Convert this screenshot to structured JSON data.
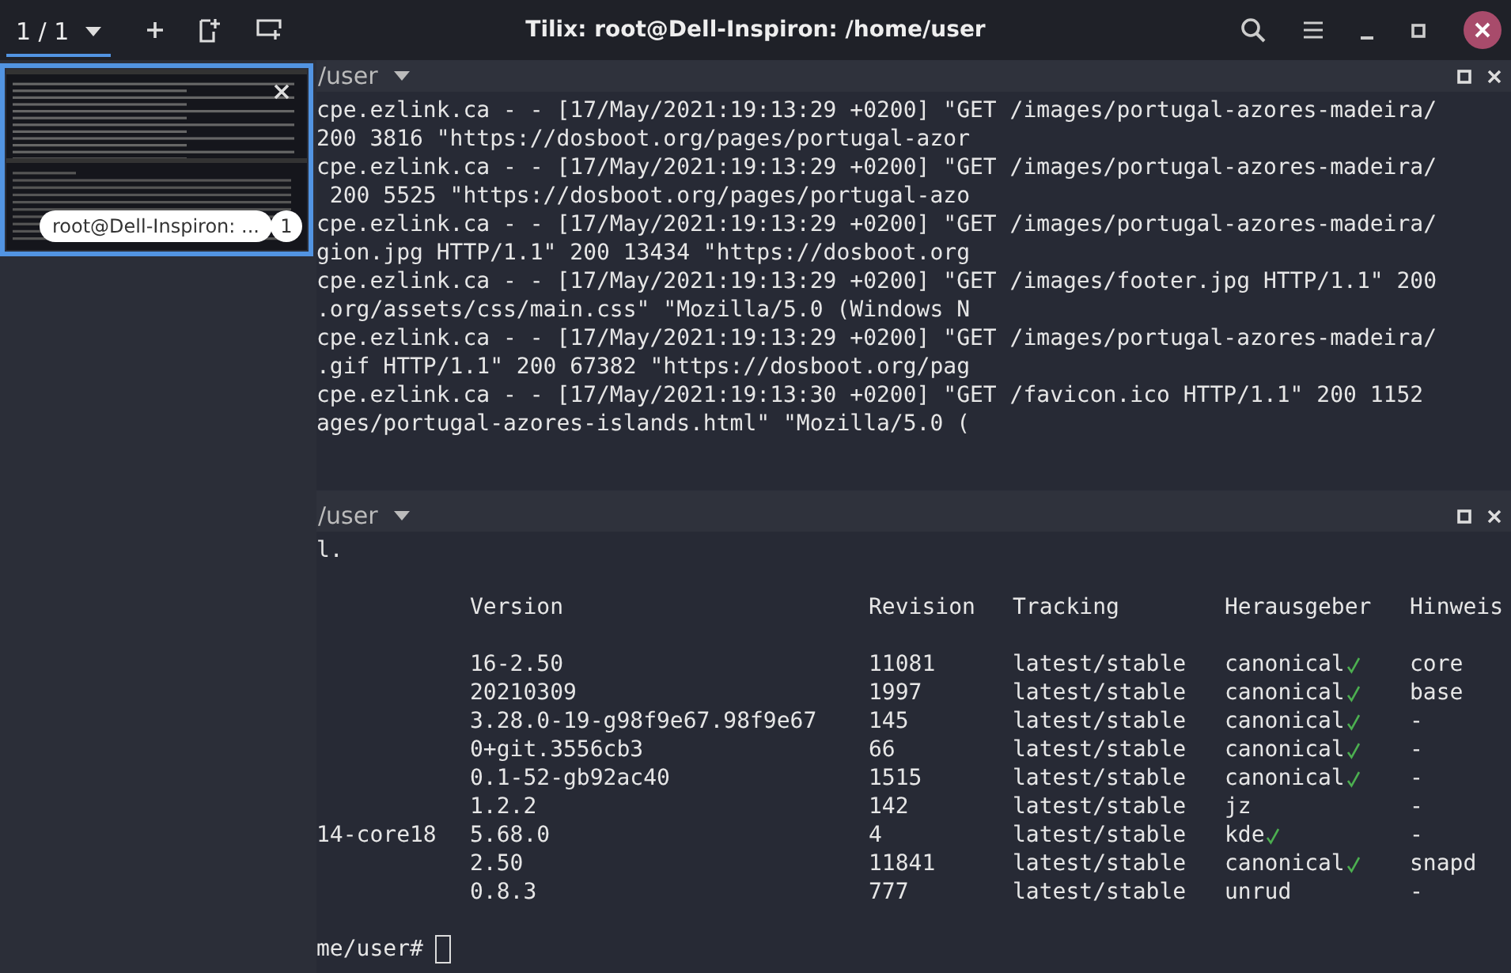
{
  "header": {
    "session_switcher": "1 / 1",
    "title": "Tilix: root@Dell-Inspiron: /home/user"
  },
  "sidebar": {
    "sessions": [
      {
        "label": "root@Dell-Inspiron: ...",
        "number": "1",
        "selected": true
      }
    ]
  },
  "panes": [
    {
      "title": "/user",
      "lines": [
        "cpe.ezlink.ca - - [17/May/2021:19:13:29 +0200] \"GET /images/portugal-azores-madeira/",
        "200 3816 \"https://dosboot.org/pages/portugal-azor",
        "cpe.ezlink.ca - - [17/May/2021:19:13:29 +0200] \"GET /images/portugal-azores-madeira/",
        " 200 5525 \"https://dosboot.org/pages/portugal-azo",
        "cpe.ezlink.ca - - [17/May/2021:19:13:29 +0200] \"GET /images/portugal-azores-madeira/",
        "gion.jpg HTTP/1.1\" 200 13434 \"https://dosboot.org",
        "cpe.ezlink.ca - - [17/May/2021:19:13:29 +0200] \"GET /images/footer.jpg HTTP/1.1\" 200",
        ".org/assets/css/main.css\" \"Mozilla/5.0 (Windows N",
        "cpe.ezlink.ca - - [17/May/2021:19:13:29 +0200] \"GET /images/portugal-azores-madeira/",
        ".gif HTTP/1.1\" 200 67382 \"https://dosboot.org/pag",
        "cpe.ezlink.ca - - [17/May/2021:19:13:30 +0200] \"GET /favicon.ico HTTP/1.1\" 200 1152",
        "ages/portugal-azores-islands.html\" \"Mozilla/5.0 ("
      ]
    },
    {
      "title": "/user",
      "lines": [
        "l."
      ],
      "table": {
        "columns": [
          "Version",
          "Revision",
          "Tracking",
          "Herausgeber",
          "Hinweis"
        ],
        "rows": [
          {
            "version": "16-2.50",
            "revision": "11081",
            "tracking": "latest/stable",
            "publisher": "canonical",
            "verified": true,
            "note": "core"
          },
          {
            "version": "20210309",
            "revision": "1997",
            "tracking": "latest/stable",
            "publisher": "canonical",
            "verified": true,
            "note": "base"
          },
          {
            "version": "3.28.0-19-g98f9e67.98f9e67",
            "revision": "145",
            "tracking": "latest/stable",
            "publisher": "canonical",
            "verified": true,
            "note": "-"
          },
          {
            "version": "0+git.3556cb3",
            "revision": "66",
            "tracking": "latest/stable",
            "publisher": "canonical",
            "verified": true,
            "note": "-"
          },
          {
            "version": "0.1-52-gb92ac40",
            "revision": "1515",
            "tracking": "latest/stable",
            "publisher": "canonical",
            "verified": true,
            "note": "-"
          },
          {
            "version": "1.2.2",
            "revision": "142",
            "tracking": "latest/stable",
            "publisher": "jz",
            "verified": false,
            "note": "-"
          },
          {
            "name": "14-core18",
            "version": "5.68.0",
            "revision": "4",
            "tracking": "latest/stable",
            "publisher": "kde",
            "verified": true,
            "note": "-"
          },
          {
            "version": "2.50",
            "revision": "11841",
            "tracking": "latest/stable",
            "publisher": "canonical",
            "verified": true,
            "note": "snapd"
          },
          {
            "version": "0.8.3",
            "revision": "777",
            "tracking": "latest/stable",
            "publisher": "unrud",
            "verified": false,
            "note": "-"
          }
        ]
      },
      "prompt": "me/user#"
    }
  ]
}
